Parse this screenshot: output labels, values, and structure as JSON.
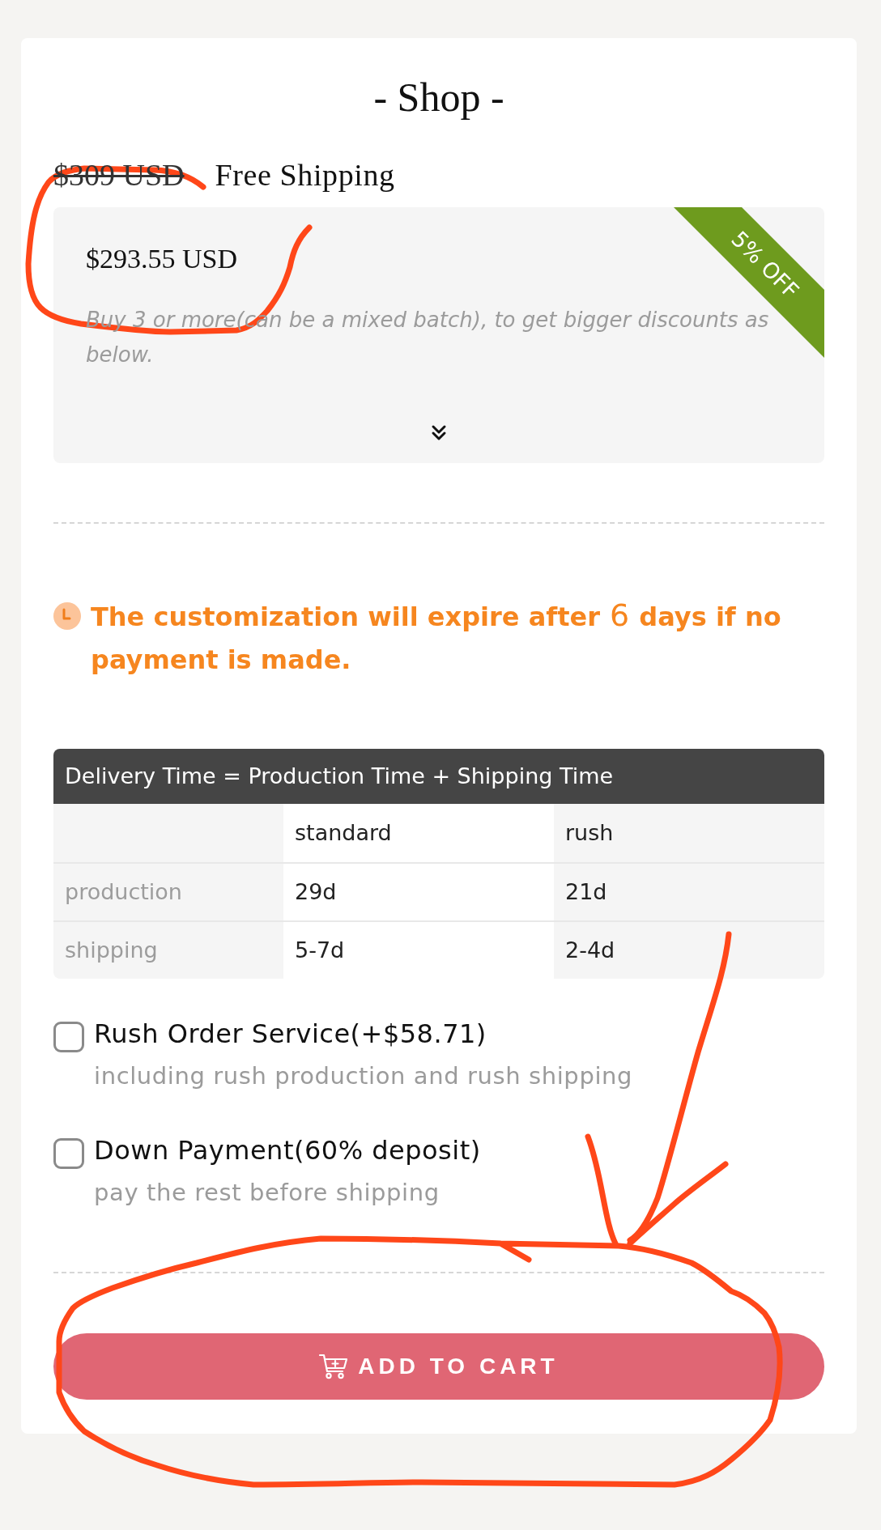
{
  "title": "- Shop -",
  "price": {
    "original": "$309 USD",
    "shipping": "Free Shipping"
  },
  "discount": {
    "price": "$293.55 USD",
    "ribbon": "5% OFF",
    "hint": "Buy 3 or more(can be a mixed batch), to get bigger discounts as below."
  },
  "notice": {
    "text": "**The customization will expire after** 6 **days if no payment is made.**"
  },
  "delivery_table": {
    "title": "Delivery Time = Production Time + Shipping Time",
    "columns": [
      "standard",
      "rush"
    ],
    "rows": [
      {
        "label": "production",
        "cells": [
          "29d",
          "21d"
        ]
      },
      {
        "label": "shipping",
        "cells": [
          "5-7d",
          "2-4d"
        ]
      }
    ]
  },
  "options": [
    {
      "label": "Rush Order Service(+$58.71)",
      "description": "including rush production and rush shipping",
      "checked": false
    },
    {
      "label": "Down Payment(60% deposit)",
      "description": "pay the rest before shipping",
      "checked": false
    }
  ],
  "add_to_cart": {
    "label": "ADD TO CART"
  },
  "annotations": [
    {
      "kind": "circle"
    },
    {
      "kind": "arrow"
    },
    {
      "kind": "circle"
    }
  ]
}
